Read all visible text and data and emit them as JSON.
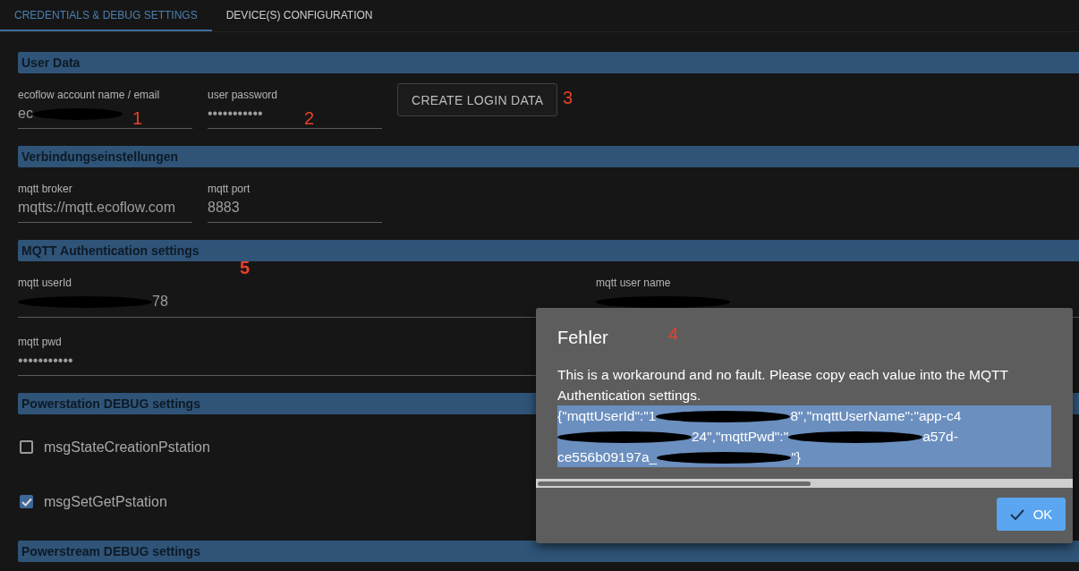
{
  "tabs": [
    {
      "label": "CREDENTIALS & DEBUG SETTINGS",
      "selected": true
    },
    {
      "label": "DEVICE(S) CONFIGURATION",
      "selected": false
    }
  ],
  "sections": [
    {
      "title": "User Data",
      "kind": "fields",
      "fields": [
        {
          "label": "ecoflow account name / email",
          "value": [
            {
              "kind": "text",
              "text": "ec"
            },
            {
              "kind": "redacted"
            }
          ],
          "note": "1"
        },
        {
          "label": "user password",
          "value": [
            {
              "kind": "text",
              "text": "•••••••••••"
            }
          ],
          "note": "2"
        }
      ],
      "button": {
        "label": "CREATE LOGIN DATA",
        "note": "3"
      }
    },
    {
      "title": "Verbindungseinstellungen",
      "kind": "fields",
      "fields": [
        {
          "label": "mqtt broker",
          "value": [
            {
              "kind": "text",
              "text": "mqtts://mqtt.ecoflow.com"
            }
          ]
        },
        {
          "label": "mqtt port",
          "value": [
            {
              "kind": "text",
              "text": "8883"
            }
          ]
        }
      ]
    },
    {
      "title": "MQTT Authentication settings",
      "kind": "field-grid",
      "note": "5",
      "fields": [
        {
          "label": "mqtt userId",
          "value": [
            {
              "kind": "redacted"
            },
            {
              "kind": "text",
              "text": "78"
            }
          ]
        },
        {
          "label": "mqtt user name",
          "value": [
            {
              "kind": "redacted"
            }
          ]
        },
        {
          "label": "mqtt pwd",
          "value": [
            {
              "kind": "text",
              "text": "•••••••••••"
            }
          ]
        }
      ]
    },
    {
      "title": "Powerstation DEBUG settings",
      "kind": "checks",
      "checks": [
        {
          "label": "msgStateCreationPstation",
          "checked": false
        },
        {
          "label": "msgSetGetPstation",
          "checked": true
        }
      ]
    },
    {
      "title": "Powerstream DEBUG settings",
      "kind": "header"
    }
  ],
  "dialog": {
    "title": "Fehler",
    "note": "4",
    "message": "This is a workaround and no fault. Please copy each value into the MQTT Authentication settings.",
    "selection": [
      {
        "kind": "text",
        "text": "{\"mqttUserId\":\"1"
      },
      {
        "kind": "redacted"
      },
      {
        "kind": "text",
        "text": "8\",\"mqttUserName\":\"app-c4"
      },
      {
        "kind": "redacted"
      },
      {
        "kind": "text",
        "text": "24\",\"mqttPwd\":\""
      },
      {
        "kind": "redacted"
      },
      {
        "kind": "text",
        "text": "a57d-ce556b09197a_"
      },
      {
        "kind": "redacted"
      },
      {
        "kind": "text",
        "text": "\"}"
      }
    ],
    "button": "OK"
  }
}
